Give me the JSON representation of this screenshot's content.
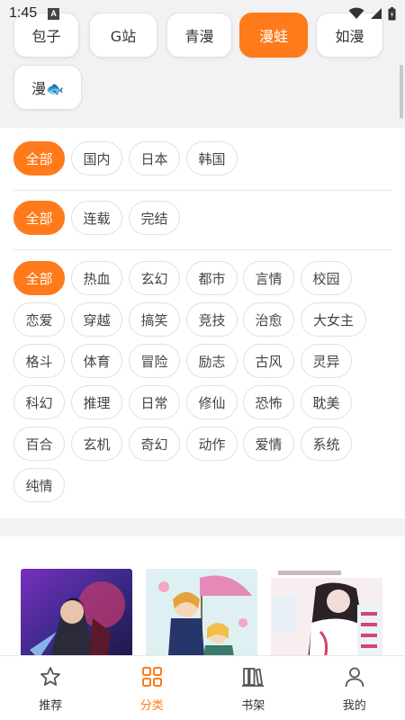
{
  "status_bar": {
    "time": "1:45",
    "notification_glyph": "A"
  },
  "sources": [
    {
      "label": "包子",
      "active": false
    },
    {
      "label": "G站",
      "active": false
    },
    {
      "label": "青漫",
      "active": false
    },
    {
      "label": "漫蛙",
      "active": true
    },
    {
      "label": "如漫",
      "active": false
    },
    {
      "label": "漫🐟",
      "active": false
    }
  ],
  "filters": {
    "region": [
      {
        "label": "全部",
        "active": true
      },
      {
        "label": "国内",
        "active": false
      },
      {
        "label": "日本",
        "active": false
      },
      {
        "label": "韩国",
        "active": false
      }
    ],
    "status": [
      {
        "label": "全部",
        "active": true
      },
      {
        "label": "连载",
        "active": false
      },
      {
        "label": "完结",
        "active": false
      }
    ],
    "genre": [
      {
        "label": "全部",
        "active": true
      },
      {
        "label": "热血",
        "active": false
      },
      {
        "label": "玄幻",
        "active": false
      },
      {
        "label": "都市",
        "active": false
      },
      {
        "label": "言情",
        "active": false
      },
      {
        "label": "校园",
        "active": false
      },
      {
        "label": "恋爱",
        "active": false
      },
      {
        "label": "穿越",
        "active": false
      },
      {
        "label": "搞笑",
        "active": false
      },
      {
        "label": "竞技",
        "active": false
      },
      {
        "label": "治愈",
        "active": false
      },
      {
        "label": "大女主",
        "active": false
      },
      {
        "label": "格斗",
        "active": false
      },
      {
        "label": "体育",
        "active": false
      },
      {
        "label": "冒险",
        "active": false
      },
      {
        "label": "励志",
        "active": false
      },
      {
        "label": "古风",
        "active": false
      },
      {
        "label": "灵异",
        "active": false
      },
      {
        "label": "科幻",
        "active": false
      },
      {
        "label": "推理",
        "active": false
      },
      {
        "label": "日常",
        "active": false
      },
      {
        "label": "修仙",
        "active": false
      },
      {
        "label": "恐怖",
        "active": false
      },
      {
        "label": "耽美",
        "active": false
      },
      {
        "label": "百合",
        "active": false
      },
      {
        "label": "玄机",
        "active": false
      },
      {
        "label": "奇幻",
        "active": false
      },
      {
        "label": "动作",
        "active": false
      },
      {
        "label": "爱情",
        "active": false
      },
      {
        "label": "系统",
        "active": false
      },
      {
        "label": "纯情",
        "active": false
      }
    ]
  },
  "bottom_nav": [
    {
      "label": "推荐",
      "icon": "star-icon",
      "active": false
    },
    {
      "label": "分类",
      "icon": "grid-icon",
      "active": true
    },
    {
      "label": "书架",
      "icon": "bookshelf-icon",
      "active": false
    },
    {
      "label": "我的",
      "icon": "person-icon",
      "active": false
    }
  ],
  "colors": {
    "accent": "#ff7a1a",
    "chip_border": "#e0e0e0",
    "background": "#f2f2f4"
  }
}
